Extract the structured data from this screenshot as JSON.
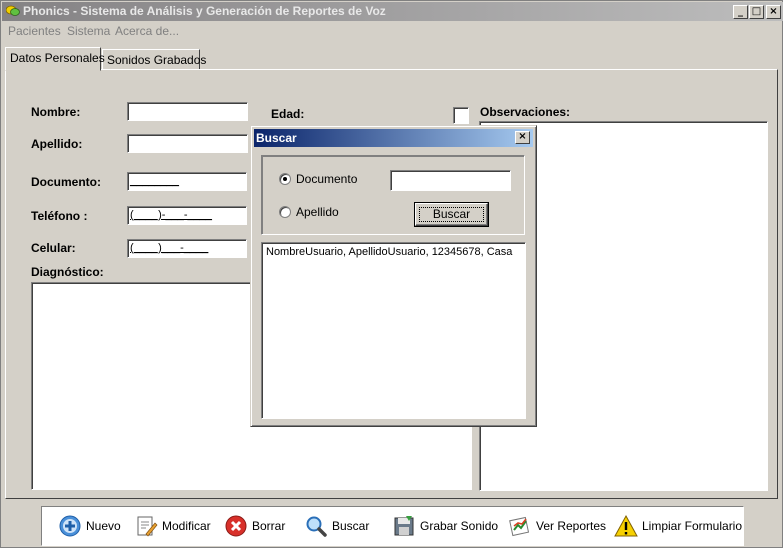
{
  "window": {
    "title": "Phonics - Sistema de Análisis y Generación de Reportes de Voz",
    "minimize": "_",
    "maximize": "□",
    "close": "×"
  },
  "menu": [
    "Pacientes",
    "Sistema",
    "Acerca de..."
  ],
  "tabs": [
    "Datos Personales",
    "Sonidos Grabados"
  ],
  "form": {
    "nombre_label": "Nombre:",
    "apellido_label": "Apellido:",
    "documento_label": "Documento:",
    "documento_mask": "________",
    "telefono_label": "Teléfono :",
    "telefono_mask": "(____)-___-____",
    "celular_label": "Celular:",
    "celular_mask": "(____)___-____",
    "diagnostico_label": "Diagnóstico:",
    "edad_label": "Edad:",
    "observaciones_label": "Observaciones:"
  },
  "dialog": {
    "title": "Buscar",
    "close": "×",
    "radio_documento": "Documento",
    "radio_apellido": "Apellido",
    "selected": "Documento",
    "search_value": "",
    "buscar_button": "Buscar",
    "results": [
      "NombreUsuario, ApellidoUsuario, 12345678, Casa"
    ]
  },
  "toolbar": {
    "nuevo": "Nuevo",
    "modificar": "Modificar",
    "borrar": "Borrar",
    "buscar": "Buscar",
    "grabar": "Grabar Sonido",
    "ver_reportes": "Ver Reportes",
    "limpiar": "Limpiar Formulario"
  },
  "icons": {
    "app": "speech-bubble-icon",
    "nuevo": "plus-circle-icon",
    "modificar": "edit-document-icon",
    "borrar": "delete-x-icon",
    "buscar": "magnifier-icon",
    "grabar": "save-disk-icon",
    "ver_reportes": "report-chart-icon",
    "limpiar": "warning-icon"
  }
}
